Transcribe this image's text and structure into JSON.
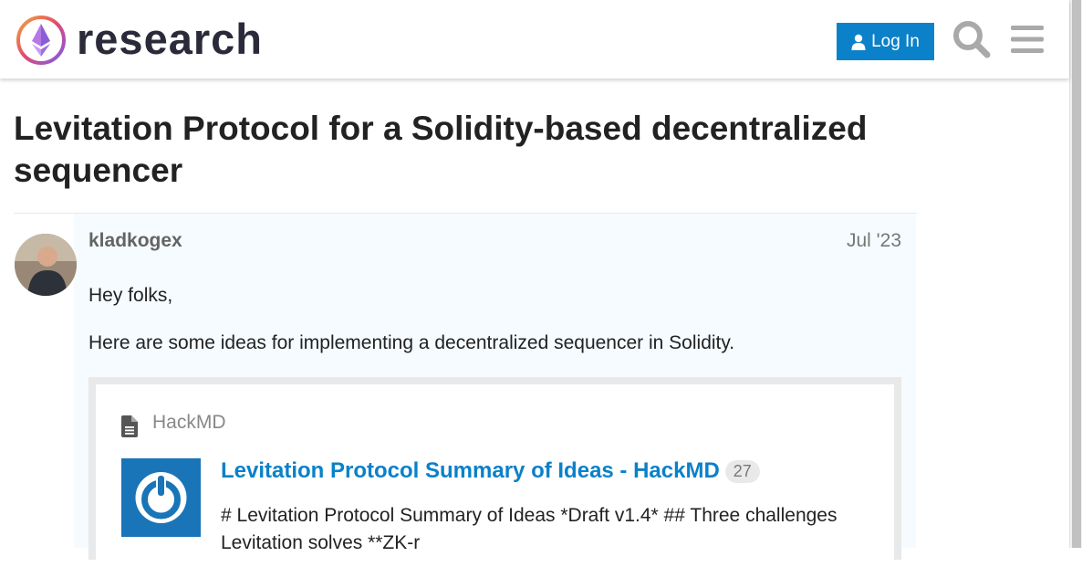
{
  "header": {
    "site_name": "research",
    "login_label": "Log In",
    "search_icon": "search-icon",
    "menu_icon": "hamburger-menu-icon"
  },
  "topic": {
    "title": "Levitation Protocol for a Solidity-based decentralized sequencer"
  },
  "post": {
    "username": "kladkogex",
    "date": "Jul '23",
    "paragraphs": [
      "Hey folks,",
      "Here are some ideas for implementing a decentralized sequencer in Solidity."
    ],
    "onebox": {
      "source": "HackMD",
      "link_title": "Levitation Protocol Summary of Ideas - HackMD",
      "click_count": "27",
      "excerpt": "# Levitation Protocol Summary of Ideas *Draft v1.4* ## Three challenges Levitation solves **ZK-r"
    }
  },
  "colors": {
    "accent": "#0a81c9",
    "post_background": "#f5fbff",
    "hackmd_blue": "#1a74b8"
  }
}
